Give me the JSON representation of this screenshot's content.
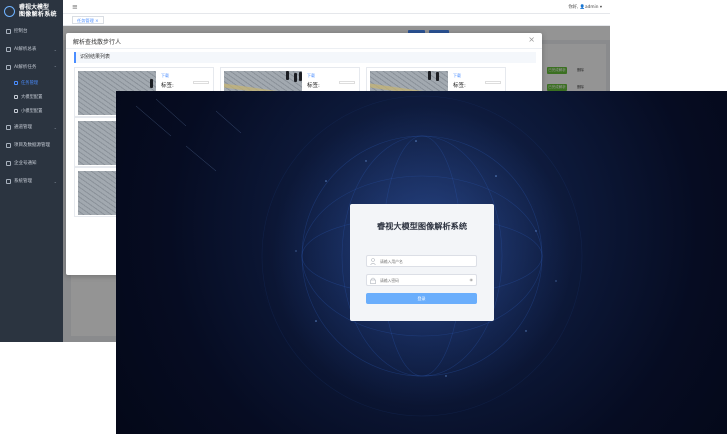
{
  "app": {
    "title_line1": "睿视大模型",
    "title_line2": "图像解析系统",
    "user": "你好, 👤admin ▾"
  },
  "sidebar": {
    "items": [
      {
        "label": "控制台"
      },
      {
        "label": "AI解析总表"
      },
      {
        "label": "AI解析任务"
      },
      {
        "label": "任务管理"
      },
      {
        "label": "大模型配置"
      },
      {
        "label": "小模型配置"
      },
      {
        "label": "通道管理"
      },
      {
        "label": "项目及数据源管理"
      },
      {
        "label": "企业号通知"
      },
      {
        "label": "系统管理"
      }
    ]
  },
  "tabs": [
    {
      "label": "任务管理 ×"
    }
  ],
  "content": {
    "green_btn": "已完成解析",
    "row_action": "删除"
  },
  "modal": {
    "title": "解析查找散步行人",
    "close": "×",
    "section": "识别结果列表",
    "cards": [
      {
        "download": "下载",
        "tag": "标签:"
      },
      {
        "download": "下载",
        "tag": "标签:"
      },
      {
        "download": "下载",
        "tag": "标签:"
      }
    ]
  },
  "login": {
    "title": "睿视大模型图像解析系统",
    "username_placeholder": "请输入用户名",
    "password_placeholder": "请输入密码",
    "button": "登录"
  },
  "colors": {
    "sidebar": "#2b3440",
    "accent": "#4a8dff",
    "login_button": "#6aaefc",
    "success": "#67c23a",
    "login_bg": "#0e1b3d"
  }
}
